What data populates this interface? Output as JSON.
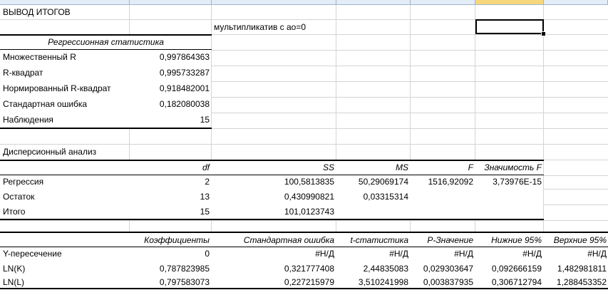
{
  "columns": [
    "A",
    "B",
    "C",
    "D",
    "E",
    "F",
    "G"
  ],
  "title": "ВЫВОД ИТОГОВ",
  "note": "мультипликатив с ао=0",
  "regression_stats": {
    "header": "Регрессионная статистика",
    "rows": [
      {
        "label": "Множественный R",
        "value": "0,997864363"
      },
      {
        "label": "R-квадрат",
        "value": "0,995733287"
      },
      {
        "label": "Нормированный R-квадрат",
        "value": "0,918482001"
      },
      {
        "label": "Стандартная ошибка",
        "value": "0,182080038"
      },
      {
        "label": "Наблюдения",
        "value": "15"
      }
    ]
  },
  "anova": {
    "title": "Дисперсионный анализ",
    "headers": [
      "",
      "df",
      "SS",
      "MS",
      "F",
      "Значимость F"
    ],
    "rows": [
      [
        "Регрессия",
        "2",
        "100,5813835",
        "50,29069174",
        "1516,92092",
        "3,73976E-15"
      ],
      [
        "Остаток",
        "13",
        "0,430990821",
        "0,03315314",
        "",
        ""
      ],
      [
        "Итого",
        "15",
        "101,0123743",
        "",
        "",
        ""
      ]
    ]
  },
  "coefficients": {
    "headers": [
      "",
      "Коэффициенты",
      "Стандартная ошибка",
      "t-статистика",
      "P-Значение",
      "Нижние 95%",
      "Верхние 95%"
    ],
    "rows": [
      [
        "Y-пересечение",
        "0",
        "#Н/Д",
        "#Н/Д",
        "#Н/Д",
        "#Н/Д",
        "#Н/Д"
      ],
      [
        "LN(K)",
        "0,787823985",
        "0,321777408",
        "2,44835083",
        "0,029303647",
        "0,092666159",
        "1,482981811"
      ],
      [
        "LN(L)",
        "0,797583073",
        "0,227215979",
        "3,510241998",
        "0,003837935",
        "0,306712794",
        "1,288453352"
      ]
    ]
  }
}
